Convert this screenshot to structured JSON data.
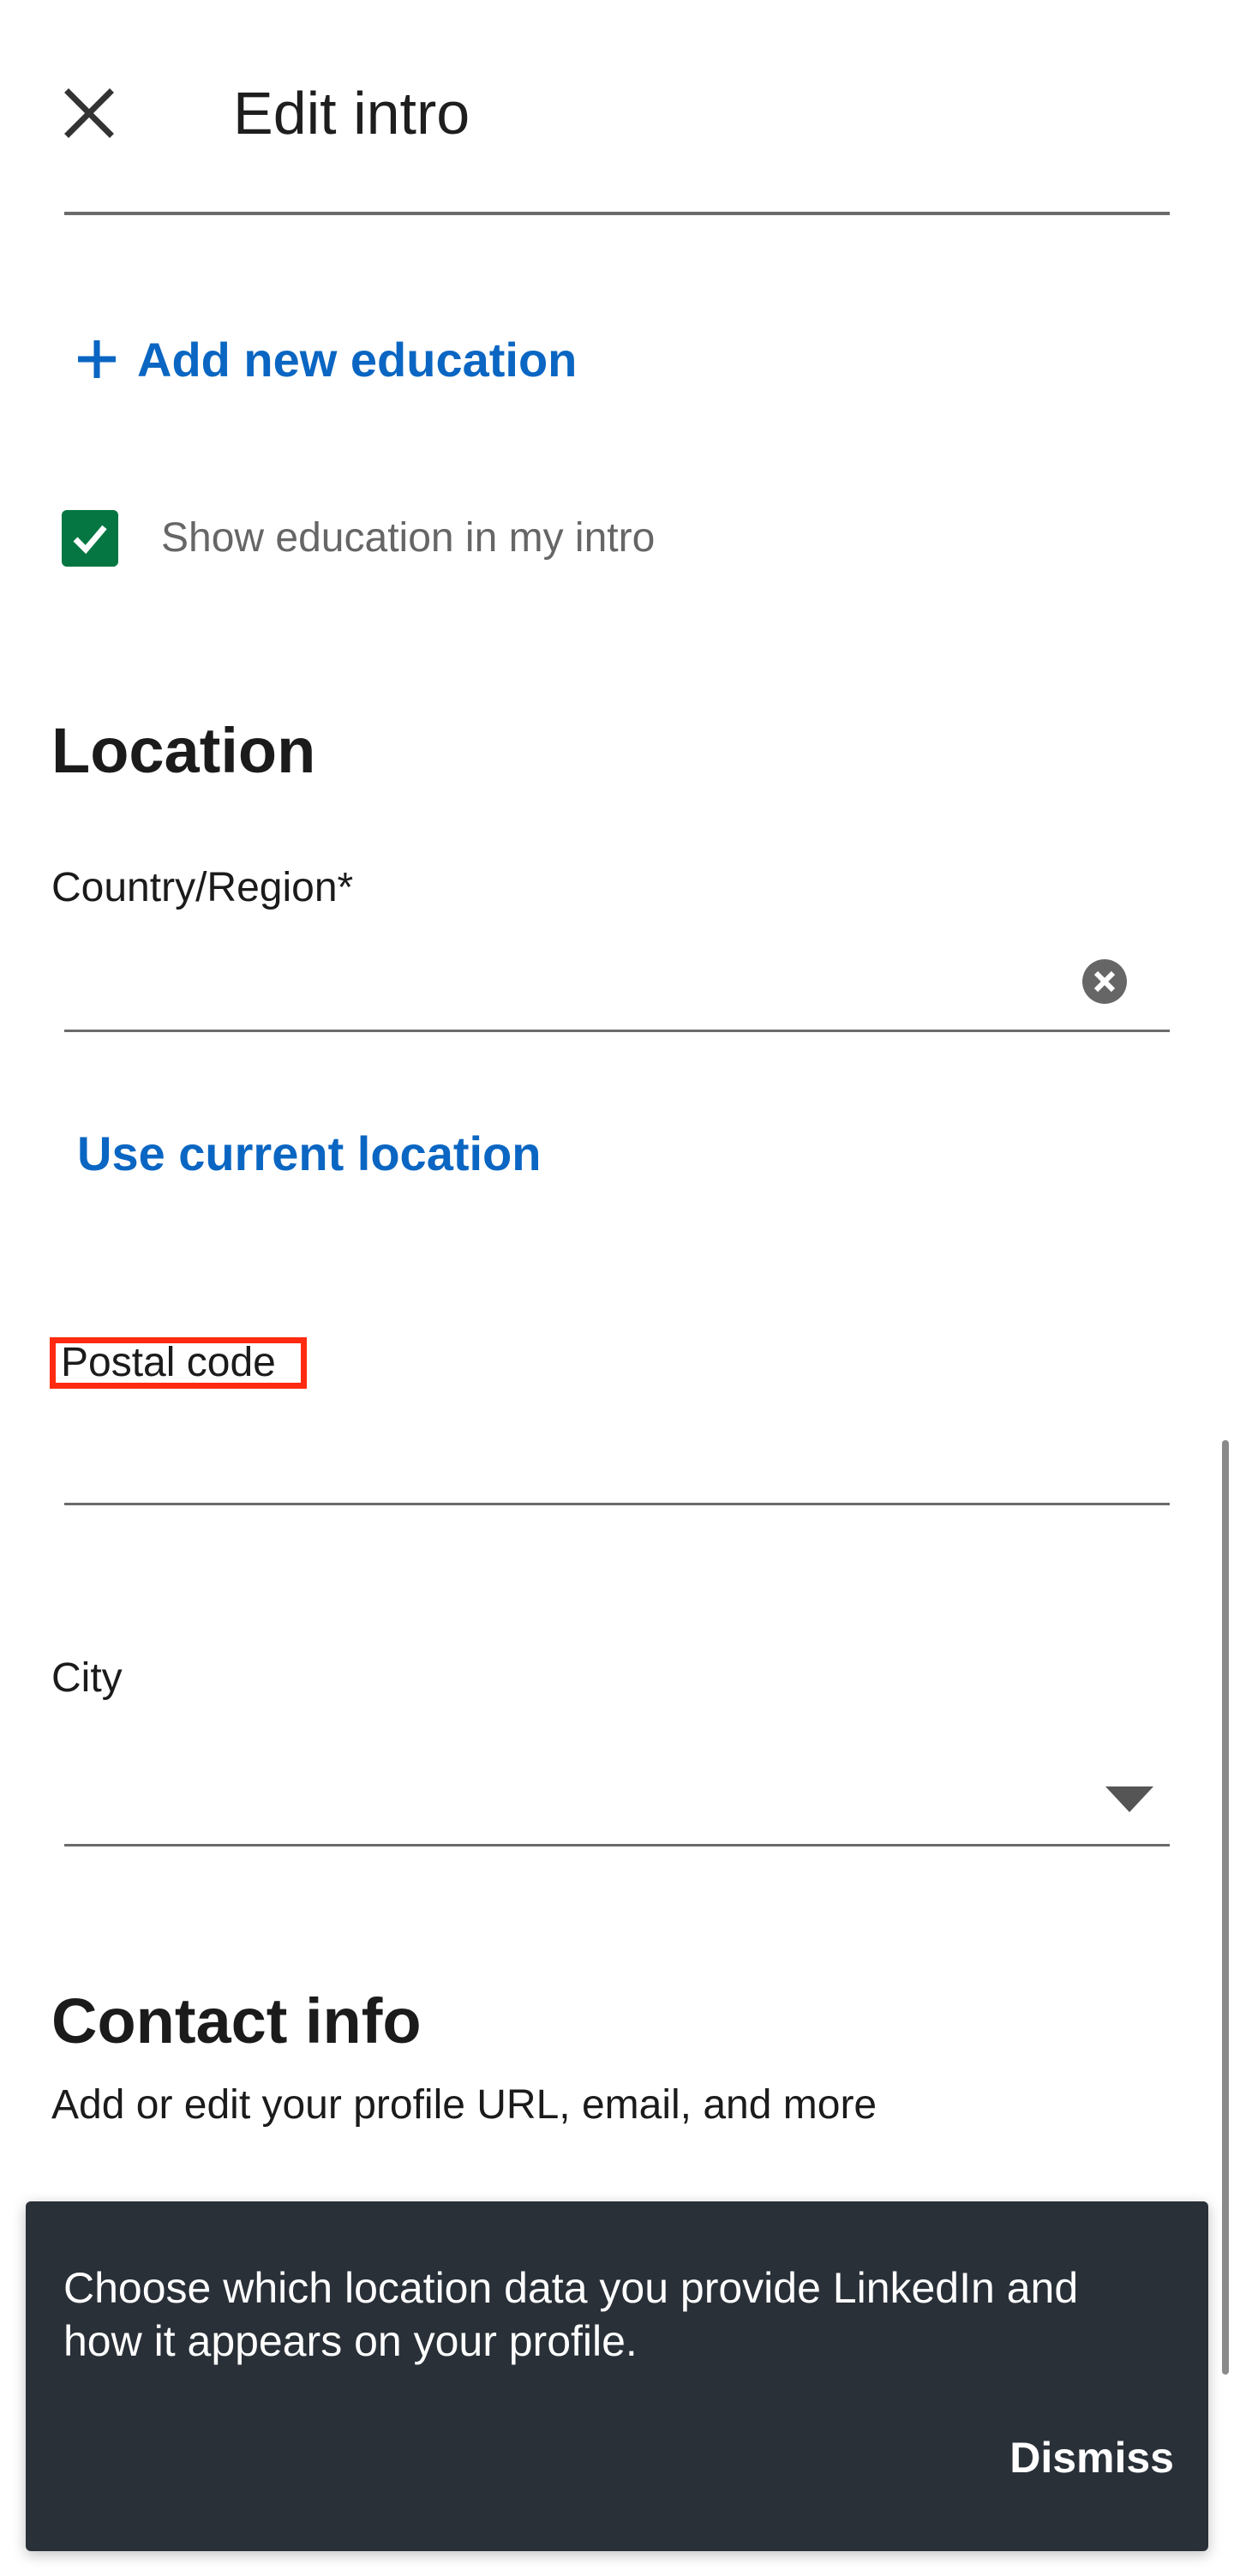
{
  "header": {
    "title": "Edit intro",
    "close_icon": "close-icon"
  },
  "education": {
    "add_label": "Add new education",
    "show_in_intro_label": "Show education in my intro",
    "show_in_intro_checked": true
  },
  "location": {
    "title": "Location",
    "country_label": "Country/Region*",
    "country_value": "",
    "use_current_location": "Use current location",
    "postal_label": "Postal code",
    "postal_value": "",
    "city_label": "City",
    "city_value": ""
  },
  "contact": {
    "title": "Contact info",
    "subtitle": "Add or edit your profile URL, email, and more"
  },
  "snackbar": {
    "message": "Choose which location data you provide LinkedIn and how it appears on your profile.",
    "dismiss_label": "Dismiss"
  },
  "colors": {
    "link_blue": "#0a66c2",
    "checkbox_green": "#057642",
    "snackbar_bg": "#293038",
    "highlight_red": "#ff2a0f"
  }
}
